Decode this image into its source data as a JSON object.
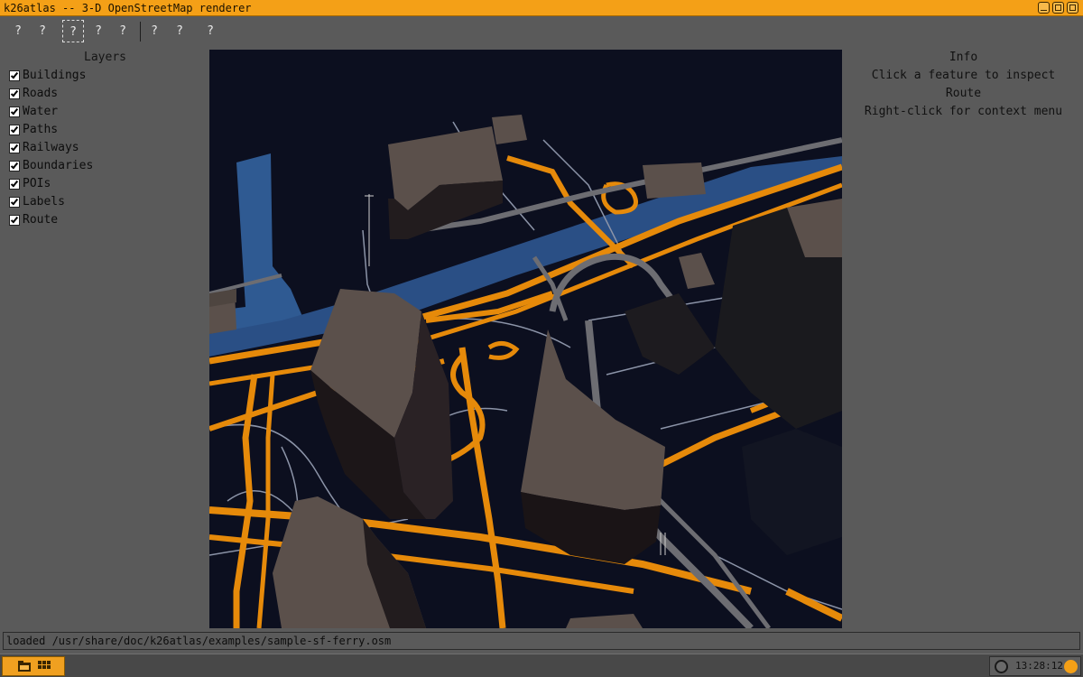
{
  "window": {
    "title": "k26atlas -- 3-D OpenStreetMap renderer",
    "buttons": [
      "minimize",
      "maximize",
      "close"
    ]
  },
  "toolbar": {
    "tools": [
      {
        "label": "?",
        "selected": false
      },
      {
        "label": "?",
        "selected": false
      },
      {
        "label": "?",
        "selected": true
      },
      {
        "label": "?",
        "selected": false
      },
      {
        "label": "?",
        "selected": false
      },
      {
        "label": "?",
        "selected": false
      },
      {
        "label": "?",
        "selected": false
      },
      {
        "label": "?",
        "selected": false
      }
    ]
  },
  "layers": {
    "title": "Layers",
    "items": [
      {
        "label": "Buildings",
        "checked": true
      },
      {
        "label": "Roads",
        "checked": true
      },
      {
        "label": "Water",
        "checked": true
      },
      {
        "label": "Paths",
        "checked": true
      },
      {
        "label": "Railways",
        "checked": true
      },
      {
        "label": "Boundaries",
        "checked": true
      },
      {
        "label": "POIs",
        "checked": true
      },
      {
        "label": "Labels",
        "checked": true
      },
      {
        "label": "Route",
        "checked": true
      }
    ]
  },
  "info": {
    "title": "Info",
    "lines": [
      "Click a feature to inspect",
      "Route",
      "Right-click for context menu"
    ]
  },
  "status": {
    "text": "loaded /usr/share/doc/k26atlas/examples/sample-sf-ferry.osm"
  },
  "taskbar": {
    "clock": "13:28:12"
  },
  "colors": {
    "accent": "#f4a017",
    "road": "#e68a0a",
    "water": "#2f5a92",
    "building": "#5a4e49",
    "map_background": "#0c0f1f"
  }
}
